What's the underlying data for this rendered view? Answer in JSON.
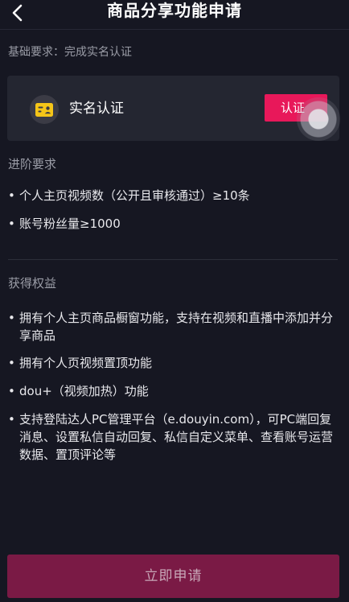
{
  "nav": {
    "title": "商品分享功能申请"
  },
  "basic_requirement": "基础要求：完成实名认证",
  "auth_card": {
    "label": "实名认证",
    "button_label": "认证"
  },
  "advanced": {
    "title": "进阶要求",
    "items": [
      "个人主页视频数（公开且审核通过）≥10条",
      "账号粉丝量≥1000"
    ]
  },
  "benefits": {
    "title": "获得权益",
    "items": [
      "拥有个人主页商品橱窗功能，支持在视频和直播中添加并分享商品",
      "拥有个人页视频置顶功能",
      "dou+（视频加热）功能",
      "支持登陆达人PC管理平台（e.douyin.com），可PC端回复消息、设置私信自动回复、私信自定义菜单、查看账号运营数据、置顶评论等"
    ]
  },
  "apply_button_label": "立即申请",
  "colors": {
    "background": "#161722",
    "card": "#242631",
    "accent": "#e8185a",
    "apply_button": "#7a1a45",
    "icon_yellow": "#f5c518"
  }
}
